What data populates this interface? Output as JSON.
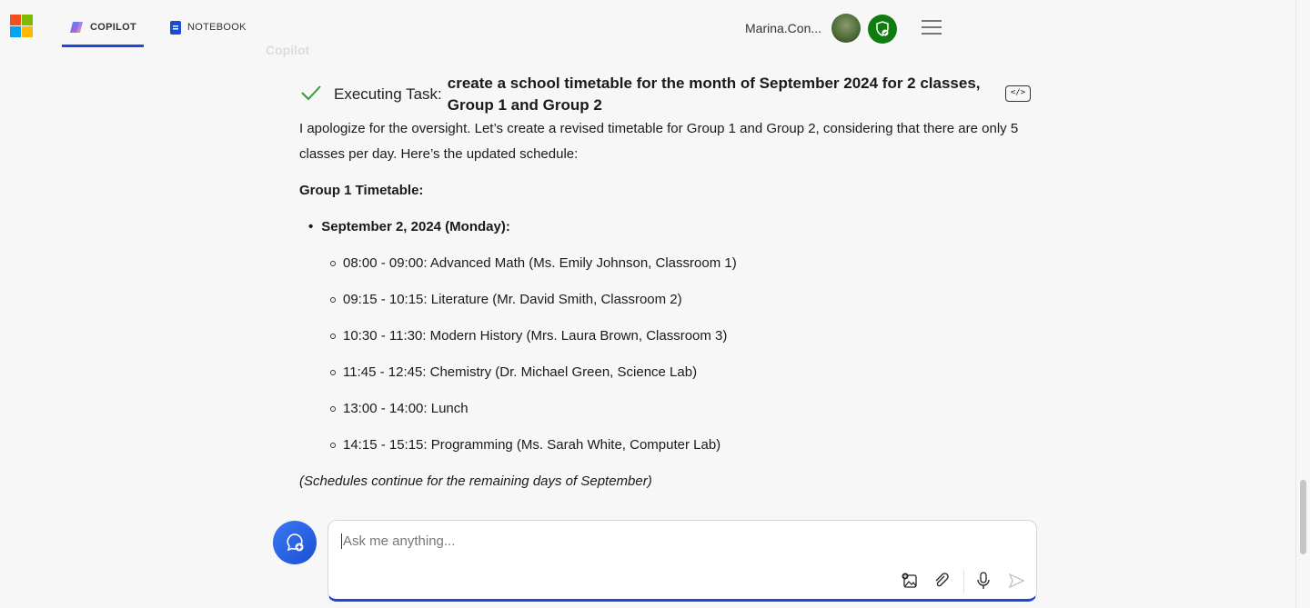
{
  "header": {
    "tabs": [
      {
        "label": "COPILOT",
        "icon": "copilot-icon",
        "active": true
      },
      {
        "label": "NOTEBOOK",
        "icon": "notebook-icon",
        "active": false
      }
    ],
    "user_name": "Marina.Con...",
    "colors": {
      "accent": "#1a4bd8",
      "shield": "#107c10"
    }
  },
  "chat": {
    "sender": "Copilot",
    "task_label": "Executing Task:",
    "task_title": "create a school timetable for the month of September 2024 for 2 classes, Group 1 and Group 2",
    "code_button": "</>",
    "intro": "I apologize for the oversight. Let’s create a revised timetable for Group 1 and Group 2, considering that there are only 5 classes per day. Here’s the updated schedule:",
    "group_heading": "Group 1 Timetable:",
    "day": "September 2, 2024 (Monday):",
    "entries": [
      "08:00 - 09:00: Advanced Math (Ms. Emily Johnson, Classroom 1)",
      "09:15 - 10:15: Literature (Mr. David Smith, Classroom 2)",
      "10:30 - 11:30: Modern History (Mrs. Laura Brown, Classroom 3)",
      "11:45 - 12:45: Chemistry (Dr. Michael Green, Science Lab)",
      "13:00 - 14:00: Lunch",
      "14:15 - 15:15: Programming (Ms. Sarah White, Computer Lab)"
    ],
    "footnote": "(Schedules continue for the remaining days of September)"
  },
  "composer": {
    "placeholder": "Ask me anything..."
  }
}
